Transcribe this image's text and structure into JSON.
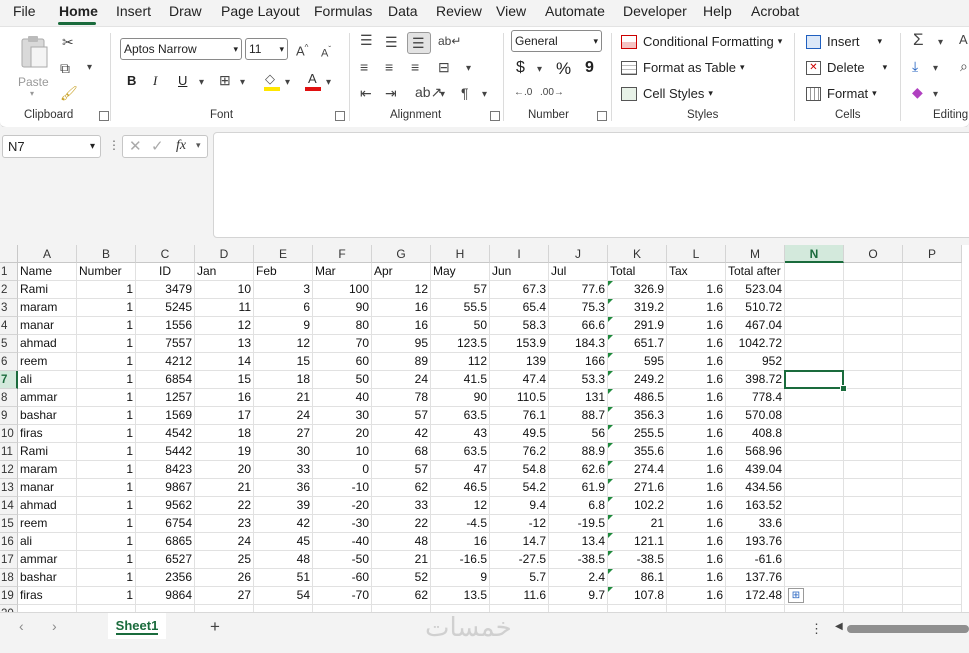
{
  "menu": {
    "items": [
      "File",
      "Home",
      "Insert",
      "Draw",
      "Page Layout",
      "Formulas",
      "Data",
      "Review",
      "View",
      "Automate",
      "Developer",
      "Help",
      "Acrobat"
    ],
    "active": "Home"
  },
  "ribbon": {
    "clipboard": {
      "paste_label": "Paste",
      "group_label": "Clipboard"
    },
    "font": {
      "font_name": "Aptos Narrow",
      "font_size": "11",
      "bold": "B",
      "italic": "I",
      "underline": "U",
      "group_label": "Font"
    },
    "alignment": {
      "group_label": "Alignment"
    },
    "number": {
      "format": "General",
      "currency": "$",
      "percent": "%",
      "comma": "9",
      "group_label": "Number"
    },
    "styles": {
      "conditional": "Conditional Formatting",
      "format_table": "Format as Table",
      "cell_styles": "Cell Styles",
      "group_label": "Styles"
    },
    "cells": {
      "insert": "Insert",
      "delete": "Delete",
      "format": "Format",
      "group_label": "Cells"
    },
    "editing": {
      "group_label": "Editing"
    }
  },
  "formula_bar": {
    "name_box": "N7",
    "fx": "fx",
    "content": ""
  },
  "grid": {
    "columns": [
      "A",
      "B",
      "C",
      "D",
      "E",
      "F",
      "G",
      "H",
      "I",
      "J",
      "K",
      "L",
      "M",
      "N",
      "O",
      "P"
    ],
    "selected_column": "N",
    "selected_row": "7",
    "active_cell": "N7",
    "header_row": [
      "Name",
      "Number",
      "ID",
      "Jan",
      "Feb",
      "Mar",
      "Apr",
      "May",
      "Jun",
      "Jul",
      "Total",
      "Tax",
      "Total after"
    ],
    "rows": [
      [
        "Rami",
        "1",
        "3479",
        "10",
        "3",
        "100",
        "12",
        "57",
        "67.3",
        "77.6",
        "326.9",
        "1.6",
        "523.04"
      ],
      [
        "maram",
        "1",
        "5245",
        "11",
        "6",
        "90",
        "16",
        "55.5",
        "65.4",
        "75.3",
        "319.2",
        "1.6",
        "510.72"
      ],
      [
        "manar",
        "1",
        "1556",
        "12",
        "9",
        "80",
        "16",
        "50",
        "58.3",
        "66.6",
        "291.9",
        "1.6",
        "467.04"
      ],
      [
        "ahmad",
        "1",
        "7557",
        "13",
        "12",
        "70",
        "95",
        "123.5",
        "153.9",
        "184.3",
        "651.7",
        "1.6",
        "1042.72"
      ],
      [
        "reem",
        "1",
        "4212",
        "14",
        "15",
        "60",
        "89",
        "112",
        "139",
        "166",
        "595",
        "1.6",
        "952"
      ],
      [
        "ali",
        "1",
        "6854",
        "15",
        "18",
        "50",
        "24",
        "41.5",
        "47.4",
        "53.3",
        "249.2",
        "1.6",
        "398.72"
      ],
      [
        "ammar",
        "1",
        "1257",
        "16",
        "21",
        "40",
        "78",
        "90",
        "110.5",
        "131",
        "486.5",
        "1.6",
        "778.4"
      ],
      [
        "bashar",
        "1",
        "1569",
        "17",
        "24",
        "30",
        "57",
        "63.5",
        "76.1",
        "88.7",
        "356.3",
        "1.6",
        "570.08"
      ],
      [
        "firas",
        "1",
        "4542",
        "18",
        "27",
        "20",
        "42",
        "43",
        "49.5",
        "56",
        "255.5",
        "1.6",
        "408.8"
      ],
      [
        "Rami",
        "1",
        "5442",
        "19",
        "30",
        "10",
        "68",
        "63.5",
        "76.2",
        "88.9",
        "355.6",
        "1.6",
        "568.96"
      ],
      [
        "maram",
        "1",
        "8423",
        "20",
        "33",
        "0",
        "57",
        "47",
        "54.8",
        "62.6",
        "274.4",
        "1.6",
        "439.04"
      ],
      [
        "manar",
        "1",
        "9867",
        "21",
        "36",
        "-10",
        "62",
        "46.5",
        "54.2",
        "61.9",
        "271.6",
        "1.6",
        "434.56"
      ],
      [
        "ahmad",
        "1",
        "9562",
        "22",
        "39",
        "-20",
        "33",
        "12",
        "9.4",
        "6.8",
        "102.2",
        "1.6",
        "163.52"
      ],
      [
        "reem",
        "1",
        "6754",
        "23",
        "42",
        "-30",
        "22",
        "-4.5",
        "-12",
        "-19.5",
        "21",
        "1.6",
        "33.6"
      ],
      [
        "ali",
        "1",
        "6865",
        "24",
        "45",
        "-40",
        "48",
        "16",
        "14.7",
        "13.4",
        "121.1",
        "1.6",
        "193.76"
      ],
      [
        "ammar",
        "1",
        "6527",
        "25",
        "48",
        "-50",
        "21",
        "-16.5",
        "-27.5",
        "-38.5",
        "-38.5",
        "1.6",
        "-61.6"
      ],
      [
        "bashar",
        "1",
        "2356",
        "26",
        "51",
        "-60",
        "52",
        "9",
        "5.7",
        "2.4",
        "86.1",
        "1.6",
        "137.76"
      ],
      [
        "firas",
        "1",
        "9864",
        "27",
        "54",
        "-70",
        "62",
        "13.5",
        "11.6",
        "9.7",
        "107.8",
        "1.6",
        "172.48"
      ]
    ]
  },
  "sheets": {
    "tabs": [
      "Sheet1"
    ],
    "active": "Sheet1",
    "add": "+"
  },
  "watermark": "خمسات"
}
